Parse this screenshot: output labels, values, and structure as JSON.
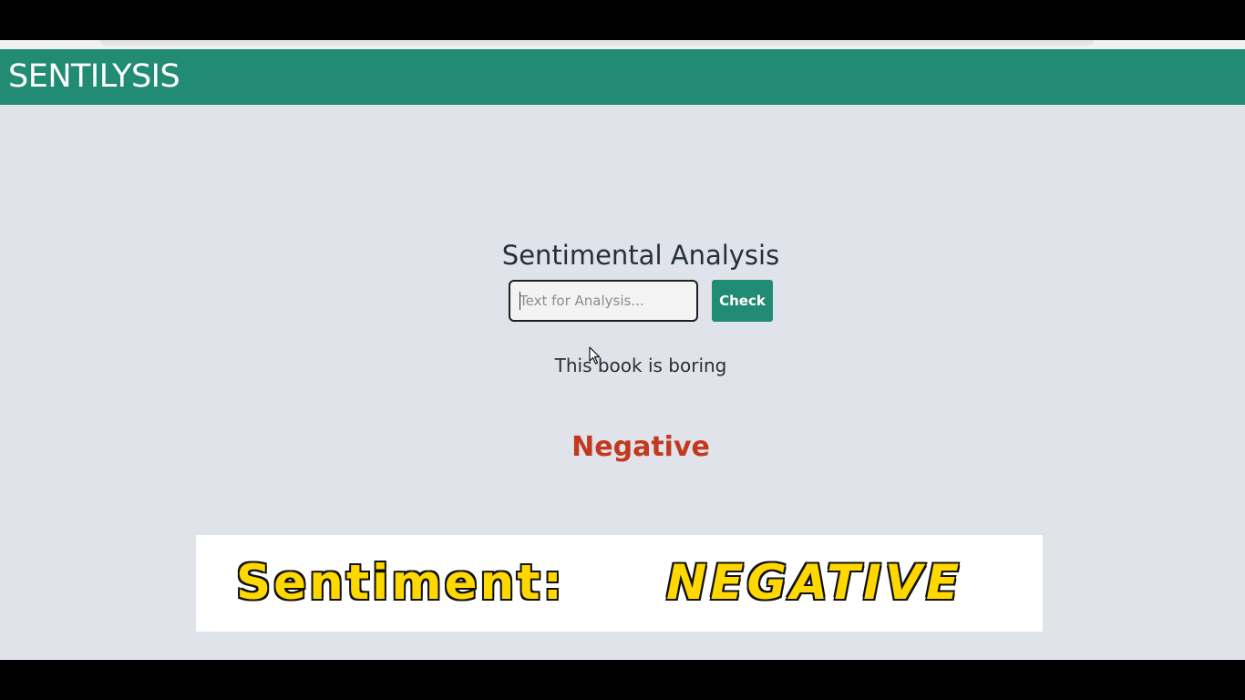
{
  "navbar": {
    "brand": "SENTILYSIS",
    "background": "#228b73"
  },
  "main": {
    "heading": "Sentimental Analysis",
    "input": {
      "placeholder": "Text for Analysis...",
      "value": ""
    },
    "check_button_label": "Check",
    "submitted_text": "This book is boring",
    "result_label": "Negative",
    "result_color": "#c2391f"
  },
  "caption_overlay": {
    "label": "Sentiment:",
    "value": "NEGATIVE",
    "text_color": "#ffd800"
  },
  "icons": [
    "mouse-pointer-icon"
  ]
}
